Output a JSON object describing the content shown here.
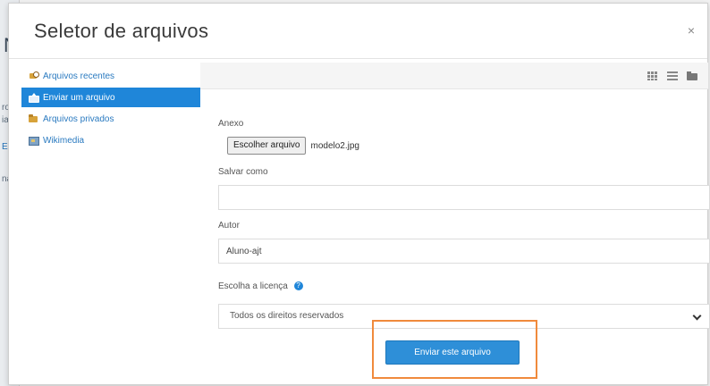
{
  "background": {
    "fragments": [
      "N",
      "ro",
      "ia",
      "E",
      "na"
    ]
  },
  "dialog": {
    "title": "Seletor de arquivos",
    "close_label": "×"
  },
  "nav": {
    "items": [
      {
        "label": "Arquivos recentes",
        "icon": "recent-files-icon",
        "active": false
      },
      {
        "label": "Enviar um arquivo",
        "icon": "upload-icon",
        "active": true
      },
      {
        "label": "Arquivos privados",
        "icon": "private-files-icon",
        "active": false
      },
      {
        "label": "Wikimedia",
        "icon": "wikimedia-icon",
        "active": false
      }
    ]
  },
  "toolbar": {
    "icons": [
      "grid-view-icon",
      "list-view-icon",
      "tree-view-icon"
    ]
  },
  "form": {
    "attachment_label": "Anexo",
    "choose_file_label": "Escolher arquivo",
    "file_name": "modelo2.jpg",
    "save_as_label": "Salvar como",
    "save_as_value": "",
    "author_label": "Autor",
    "author_value": "Aluno-ajt",
    "license_label": "Escolha a licença",
    "license_value": "Todos os direitos reservados",
    "submit_label": "Enviar este arquivo"
  },
  "colors": {
    "accent": "#1f86d9",
    "highlight": "#f08a3c"
  }
}
